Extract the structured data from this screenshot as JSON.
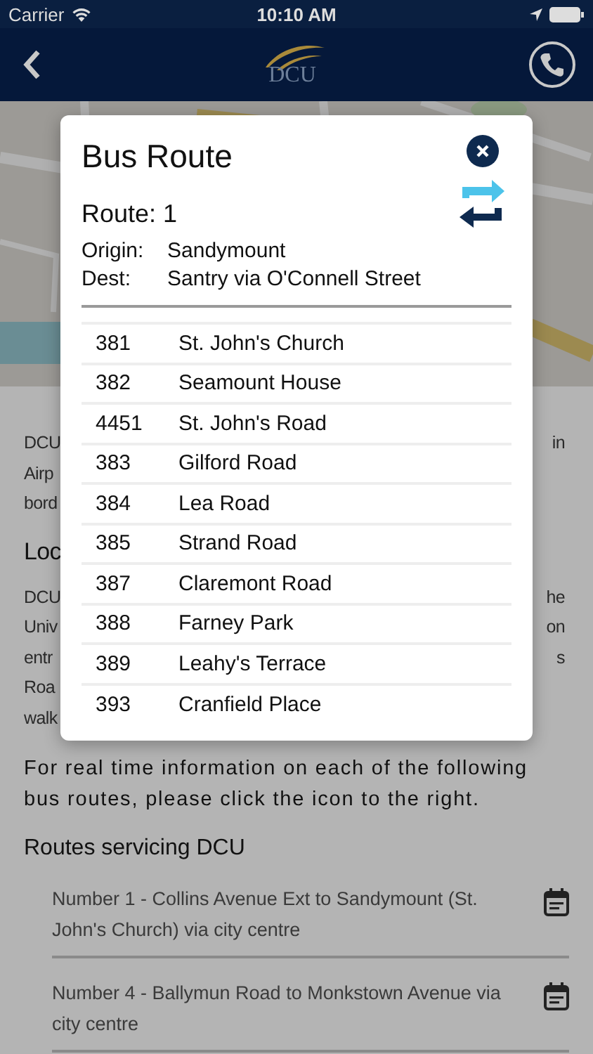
{
  "status_bar": {
    "carrier": "Carrier",
    "time": "10:10 AM"
  },
  "nav": {
    "logo_text": "DCU"
  },
  "background_text": [
    {
      "kind": "line",
      "left": "DCU",
      "right": "in"
    },
    {
      "kind": "line",
      "left": "Airp"
    },
    {
      "kind": "line",
      "left": "bord"
    },
    {
      "kind": "heading",
      "left": "Loc"
    },
    {
      "kind": "line",
      "left": "DCU",
      "right": "he"
    },
    {
      "kind": "line",
      "left": "Univ",
      "right": "on"
    },
    {
      "kind": "line",
      "left": "entr",
      "right": "s"
    },
    {
      "kind": "line",
      "left": "Roa"
    },
    {
      "kind": "line",
      "left": "walk"
    }
  ],
  "info_text": "For real time information on each of the following bus routes, please click the icon to the right.",
  "routes_heading": "Routes servicing DCU",
  "routes": [
    {
      "label": "Number 1 - Collins Avenue Ext to Sandymount (St. John's Church) via city centre"
    },
    {
      "label": "Number 4 - Ballymun Road to Monkstown Avenue via city centre"
    }
  ],
  "modal": {
    "title": "Bus Route",
    "route": "Route: 1",
    "details": [
      {
        "label": "Origin:",
        "value": "Sandymount"
      },
      {
        "label": "Dest:",
        "value": "Santry via O'Connell Street"
      }
    ],
    "stops": [
      {
        "number": "381",
        "name": "St. John's Church"
      },
      {
        "number": "382",
        "name": "Seamount House"
      },
      {
        "number": "4451",
        "name": "St. John's Road"
      },
      {
        "number": "383",
        "name": "Gilford Road"
      },
      {
        "number": "384",
        "name": "Lea Road"
      },
      {
        "number": "385",
        "name": "Strand Road"
      },
      {
        "number": "387",
        "name": "Claremont Road"
      },
      {
        "number": "388",
        "name": "Farney Park"
      },
      {
        "number": "389",
        "name": "Leahy's Terrace"
      },
      {
        "number": "393",
        "name": "Cranfield Place"
      }
    ]
  }
}
